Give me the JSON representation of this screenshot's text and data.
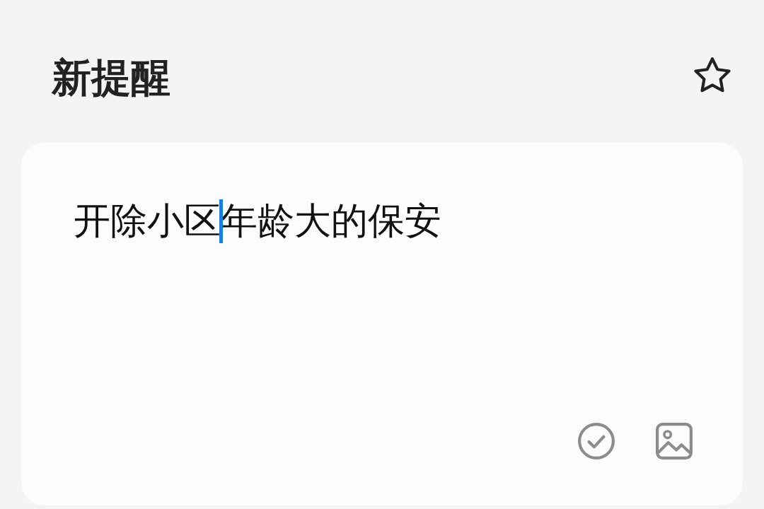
{
  "header": {
    "title": "新提醒",
    "favorite": false
  },
  "note": {
    "text_before_caret": "开除小区",
    "text_after_caret": "年龄大的保安",
    "focused": true
  }
}
